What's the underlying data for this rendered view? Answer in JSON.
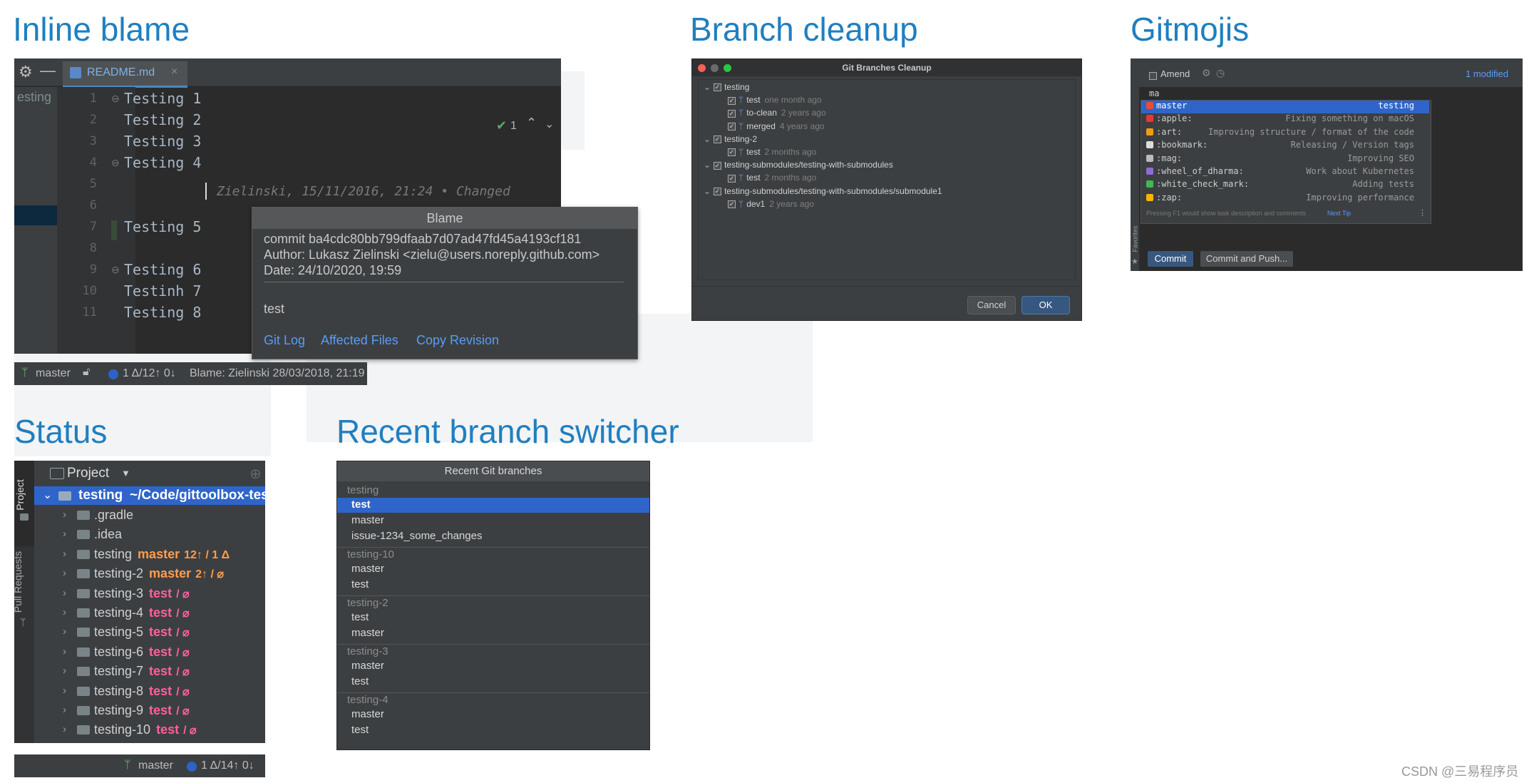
{
  "titles": {
    "inline_blame": "Inline blame",
    "branch_cleanup": "Branch cleanup",
    "gitmojis": "Gitmojis",
    "status": "Status",
    "recent_branch": "Recent branch switcher"
  },
  "inline_blame": {
    "tab_label": "README.md",
    "side_text": "esting",
    "inspections_count": "1",
    "lines": [
      {
        "num": "1",
        "text": "Testing 1"
      },
      {
        "num": "2",
        "text": "Testing 2"
      },
      {
        "num": "3",
        "text": "Testing 3"
      },
      {
        "num": "4",
        "text": "Testing 4"
      },
      {
        "num": "5",
        "text": ""
      },
      {
        "num": "6",
        "text": ""
      },
      {
        "num": "7",
        "text": "Testing 5"
      },
      {
        "num": "8",
        "text": ""
      },
      {
        "num": "9",
        "text": "Testing 6"
      },
      {
        "num": "10",
        "text": "Testinh 7"
      },
      {
        "num": "11",
        "text": "Testing 8"
      }
    ],
    "inline_annotation": "Zielinski, 15/11/2016, 21:24 • Changed",
    "popup": {
      "header": "Blame",
      "commit": "commit ba4cdc80bb799dfaab7d07ad47fd45a4193cf181",
      "author": "Author: Lukasz Zielinski <zielu@users.noreply.github.com>",
      "date": "Date: 24/10/2020, 19:59",
      "message": "test",
      "links": [
        "Git Log",
        "Affected Files",
        "Copy Revision"
      ]
    },
    "status": {
      "branch": "master",
      "counts": "1 Δ/12↑ 0↓",
      "blame": "Blame: Zielinski 28/03/2018, 21:19"
    }
  },
  "branch_cleanup": {
    "window_title": "Git Branches Cleanup",
    "tree": [
      {
        "label": "testing",
        "when": "",
        "level": 0
      },
      {
        "label": "test",
        "when": "one month ago",
        "level": 1
      },
      {
        "label": "to-clean",
        "when": "2 years ago",
        "level": 1
      },
      {
        "label": "merged",
        "when": "4 years ago",
        "level": 1
      },
      {
        "label": "testing-2",
        "when": "",
        "level": 0
      },
      {
        "label": "test",
        "when": "2 months ago",
        "level": 1
      },
      {
        "label": "testing-submodules/testing-with-submodules",
        "when": "",
        "level": 0
      },
      {
        "label": "test",
        "when": "2 months ago",
        "level": 1
      },
      {
        "label": "testing-submodules/testing-with-submodules/submodule1",
        "when": "",
        "level": 0
      },
      {
        "label": "dev1",
        "when": "2 years ago",
        "level": 1
      }
    ],
    "cancel": "Cancel",
    "ok": "OK"
  },
  "gitmojis": {
    "amend": "Amend",
    "modified": "1 modified",
    "input": "ma",
    "items": [
      {
        "code": "master",
        "desc": "testing"
      },
      {
        "code": ":apple:",
        "desc": "Fixing something on macOS"
      },
      {
        "code": ":art:",
        "desc": "Improving structure / format of the code"
      },
      {
        "code": ":bookmark:",
        "desc": "Releasing / Version tags"
      },
      {
        "code": ":mag:",
        "desc": "Improving SEO"
      },
      {
        "code": ":wheel_of_dharma:",
        "desc": "Work about Kubernetes"
      },
      {
        "code": ":white_check_mark:",
        "desc": "Adding tests"
      },
      {
        "code": ":zap:",
        "desc": "Improving performance"
      }
    ],
    "icon_colors": [
      "#e74c3c",
      "#e53935",
      "#f39c12",
      "#dddddd",
      "#bbbbbb",
      "#8e6bd6",
      "#3fb950",
      "#ffb300"
    ],
    "tip": "Pressing F1 would show task description and comments",
    "tip_link": "Next Tip",
    "commit": "Commit",
    "commit_push": "Commit and Push...",
    "side_label": "Favorites"
  },
  "status_panel": {
    "header": "Project",
    "side_tabs": [
      "Project",
      "Pull Requests"
    ],
    "root": {
      "name": "testing",
      "path": "~/Code/gittoolbox-test"
    },
    "rows": [
      {
        "name": ".gradle",
        "branch": "",
        "info": "",
        "color": ""
      },
      {
        "name": ".idea",
        "branch": "",
        "info": "",
        "color": ""
      },
      {
        "name": "testing",
        "branch": "master",
        "info": "12↑ / 1 Δ",
        "color": "orange"
      },
      {
        "name": "testing-2",
        "branch": "master",
        "info": "2↑ / ⌀",
        "color": "orange"
      },
      {
        "name": "testing-3",
        "branch": "test",
        "info": "/ ⌀",
        "color": "pink"
      },
      {
        "name": "testing-4",
        "branch": "test",
        "info": "/ ⌀",
        "color": "pink"
      },
      {
        "name": "testing-5",
        "branch": "test",
        "info": "/ ⌀",
        "color": "pink"
      },
      {
        "name": "testing-6",
        "branch": "test",
        "info": "/ ⌀",
        "color": "pink"
      },
      {
        "name": "testing-7",
        "branch": "test",
        "info": "/ ⌀",
        "color": "pink"
      },
      {
        "name": "testing-8",
        "branch": "test",
        "info": "/ ⌀",
        "color": "pink"
      },
      {
        "name": "testing-9",
        "branch": "test",
        "info": "/ ⌀",
        "color": "pink"
      },
      {
        "name": "testing-10",
        "branch": "test",
        "info": "/ ⌀",
        "color": "pink"
      }
    ],
    "status_branch": "master",
    "status_counts": "1 Δ/14↑ 0↓"
  },
  "recent_branches": {
    "header": "Recent Git branches",
    "groups": [
      {
        "name": "testing",
        "branches": [
          "test",
          "master",
          "issue-1234_some_changes"
        ]
      },
      {
        "name": "testing-10",
        "branches": [
          "master",
          "test"
        ]
      },
      {
        "name": "testing-2",
        "branches": [
          "test",
          "master"
        ]
      },
      {
        "name": "testing-3",
        "branches": [
          "master",
          "test"
        ]
      },
      {
        "name": "testing-4",
        "branches": [
          "master",
          "test"
        ]
      }
    ],
    "selected": "test"
  },
  "watermark": "CSDN @三易程序员"
}
